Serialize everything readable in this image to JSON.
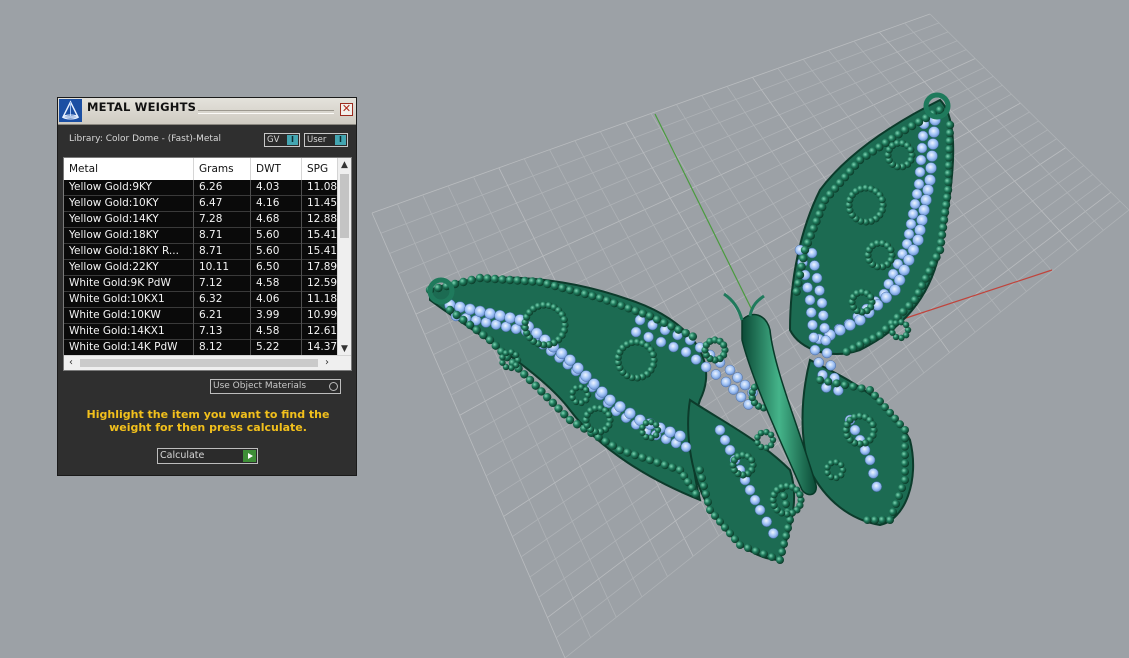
{
  "panel": {
    "title": "METAL WEIGHTS",
    "close_glyph": "✕",
    "library_label": "Library: Color Dome - (Fast)-Metal",
    "toggles": [
      {
        "label": "GV",
        "knob": "I"
      },
      {
        "label": "User",
        "knob": "I"
      }
    ],
    "table": {
      "columns": [
        "Metal",
        "Grams",
        "DWT",
        "SPG"
      ],
      "rows": [
        [
          "Yellow Gold:9KY",
          "6.26",
          "4.03",
          "11.08"
        ],
        [
          "Yellow Gold:10KY",
          "6.47",
          "4.16",
          "11.45"
        ],
        [
          "Yellow Gold:14KY",
          "7.28",
          "4.68",
          "12.88"
        ],
        [
          "Yellow Gold:18KY",
          "8.71",
          "5.60",
          "15.41"
        ],
        [
          "Yellow Gold:18KY R...",
          "8.71",
          "5.60",
          "15.41"
        ],
        [
          "Yellow Gold:22KY",
          "10.11",
          "6.50",
          "17.89"
        ],
        [
          "White Gold:9K PdW",
          "7.12",
          "4.58",
          "12.59"
        ],
        [
          "White Gold:10KX1",
          "6.32",
          "4.06",
          "11.18"
        ],
        [
          "White Gold:10KW",
          "6.21",
          "3.99",
          "10.99"
        ],
        [
          "White Gold:14KX1",
          "7.13",
          "4.58",
          "12.61"
        ],
        [
          "White Gold:14K PdW",
          "8.12",
          "5.22",
          "14.37"
        ]
      ]
    },
    "use_object_materials_label": "Use Object Materials",
    "hint": "Highlight the item you want to find the weight for then press calculate.",
    "calculate_label": "Calculate"
  },
  "icons": {
    "app": "rhino-gem-icon",
    "close": "close-icon",
    "scroll_up": "chevron-up-icon",
    "scroll_down": "chevron-down-icon",
    "scroll_left": "chevron-left-icon",
    "scroll_right": "chevron-right-icon",
    "calculate": "play-icon"
  },
  "colors": {
    "viewport_bg": "#9ca1a6",
    "model_green": "#1f7a5c",
    "gem_blue": "#8fb6f0",
    "hint_yellow": "#f2c01c",
    "axis_x": "#c0443c",
    "axis_y": "#4a9b3e"
  }
}
